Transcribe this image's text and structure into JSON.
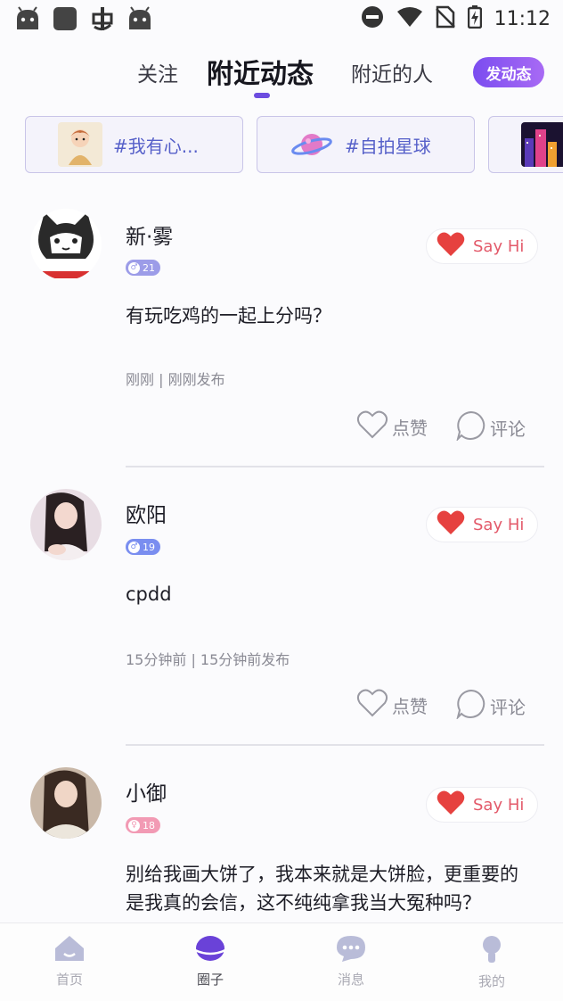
{
  "status_bar": {
    "time": "11:12",
    "left_icons": [
      "android-robot-icon",
      "app-square-icon",
      "bug-icon",
      "android-robot-icon"
    ],
    "right_icons": [
      "do-not-disturb-icon",
      "wifi-icon",
      "no-sim-icon",
      "battery-charging-icon"
    ]
  },
  "top_tabs": {
    "follow": "关注",
    "nearby_posts": "附近动态",
    "nearby_people": "附近的人",
    "active": "附近动态",
    "post_button": "发动态",
    "accent_color": "#6c4ce0"
  },
  "topics": [
    {
      "label": "#我有心...",
      "icon": "character-thumbnail"
    },
    {
      "label": "#自拍星球",
      "icon": "planet-icon"
    },
    {
      "label": "",
      "icon": "city-thumbnail"
    }
  ],
  "posts": [
    {
      "username": "新·雾",
      "badge_text": "21",
      "badge_color": "#8f8fe6",
      "say_hi": "Say Hi",
      "content": "有玩吃鸡的一起上分吗？",
      "meta": "刚刚 | 刚刚发布",
      "like": "点赞",
      "comment": "评论",
      "avatar": "cat-cartoon-avatar"
    },
    {
      "username": "欧阳",
      "badge_text": "19",
      "badge_color": "#6f86f0",
      "say_hi": "Say Hi",
      "content": "cpdd",
      "meta": "15分钟前 | 15分钟前发布",
      "like": "点赞",
      "comment": "评论",
      "avatar": "girl-photo-avatar"
    },
    {
      "username": "小御",
      "badge_text": "18",
      "badge_color": "#f08aa8",
      "say_hi": "Say Hi",
      "content": "别给我画大饼了，我本来就是大饼脸，更重要的是我真的会信，这不纯纯拿我当大冤种吗？",
      "avatar": "girl-photo-avatar"
    }
  ],
  "bottom_nav": {
    "items": [
      {
        "label": "首页",
        "icon": "home-icon"
      },
      {
        "label": "圈子",
        "icon": "planet-icon"
      },
      {
        "label": "消息",
        "icon": "chat-bubble-icon"
      },
      {
        "label": "我的",
        "icon": "person-icon"
      }
    ],
    "active": "圈子"
  }
}
